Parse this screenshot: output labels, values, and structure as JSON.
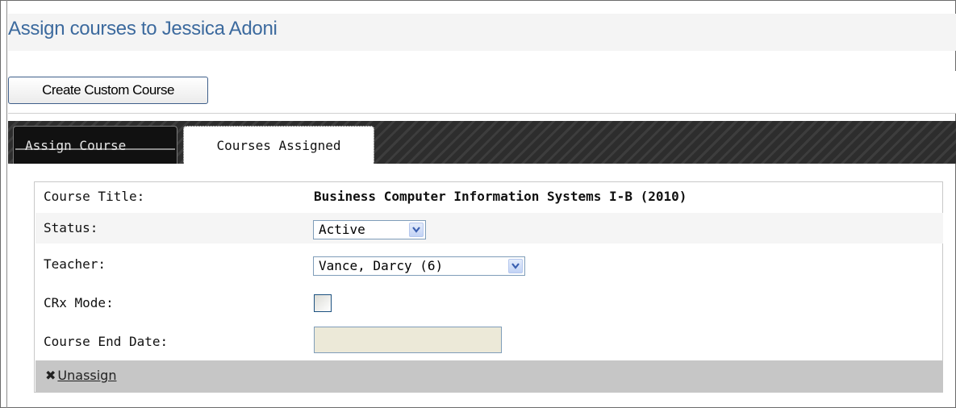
{
  "header": {
    "title": "Assign courses to Jessica Adoni"
  },
  "toolbar": {
    "create_custom_course_label": "Create Custom Course"
  },
  "tabs": [
    {
      "label": "Assign Course",
      "active": false
    },
    {
      "label": "Courses Assigned",
      "active": true
    }
  ],
  "course": {
    "title_label": "Course Title:",
    "title_value": "Business Computer Information Systems I-B (2010)",
    "status_label": "Status:",
    "status_value": "Active",
    "teacher_label": "Teacher:",
    "teacher_value": "Vance, Darcy (6)",
    "crx_label": "CRx Mode:",
    "crx_checked": false,
    "end_date_label": "Course End Date:",
    "end_date_value": "",
    "unassign_label": "Unassign"
  },
  "icons": {
    "unassign": "close-x-icon",
    "dropdown": "chevron-down-icon"
  },
  "colors": {
    "title": "#3c6a9e",
    "tab_strip": "#2a2a2a",
    "footer_bar": "#c6c6c6"
  }
}
